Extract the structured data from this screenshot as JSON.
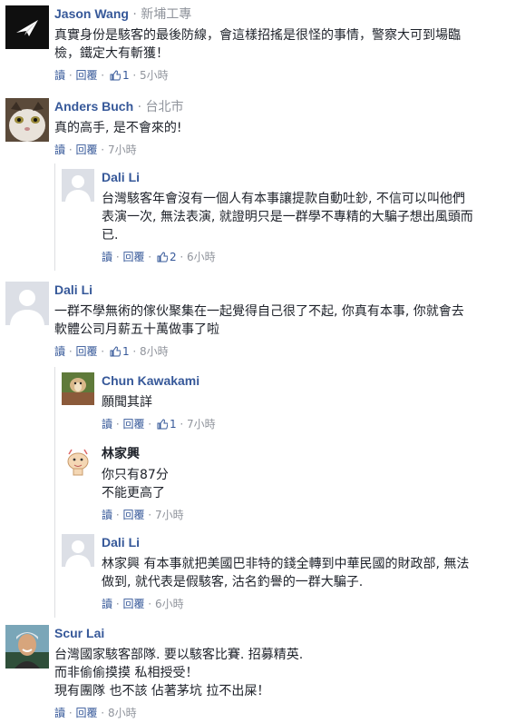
{
  "ui": {
    "reply": "讀",
    "dot": " · ",
    "reply_label": "回覆",
    "like_icon": "thumbs-up-icon"
  },
  "comments": [
    {
      "name": "Jason Wang",
      "location": "新埔工專",
      "text": "真實身份是駭客的最後防線，會這樣招搖是很怪的事情，警察大可到場臨\n檢，鐵定大有斬獲！",
      "likes": "1",
      "time": "5小時"
    },
    {
      "name": "Anders Buch",
      "location": "台北市",
      "text": "真的高手, 是不會來的!",
      "likes": "",
      "time": "7小時"
    },
    {
      "name": "Dali Li",
      "location": "",
      "text": "台灣駭客年會沒有一個人有本事讓提款自動吐鈔, 不信可以叫他們\n表演一次, 無法表演, 就證明只是一群學不專精的大騙子想出風頭而\n已.",
      "likes": "2",
      "time": "6小時"
    },
    {
      "name": "Dali Li",
      "location": "",
      "text": "一群不學無術的傢伙聚集在一起覺得自己很了不起, 你真有本事, 你就會去\n軟體公司月薪五十萬做事了啦",
      "likes": "1",
      "time": "8小時"
    },
    {
      "name": "Chun Kawakami",
      "location": "",
      "text": "願聞其詳",
      "likes": "1",
      "time": "7小時"
    },
    {
      "name": "林家興",
      "location": "",
      "text": "你只有87分\n不能更高了",
      "likes": "",
      "time": "7小時"
    },
    {
      "name": "Dali Li",
      "location": "",
      "text": "林家興 有本事就把美國巴非特的錢全轉到中華民國的財政部, 無法\n做到, 就代表是假駭客, 沽名釣譽的一群大騙子.",
      "likes": "",
      "time": "6小時"
    },
    {
      "name": "Scur Lai",
      "location": "",
      "text": "台灣國家駭客部隊. 要以駭客比賽. 招募精英.\n而非偷偷摸摸 私相授受！\n現有團隊 也不該 佔著茅坑 拉不出屎！",
      "likes": "",
      "time": "8小時"
    }
  ]
}
